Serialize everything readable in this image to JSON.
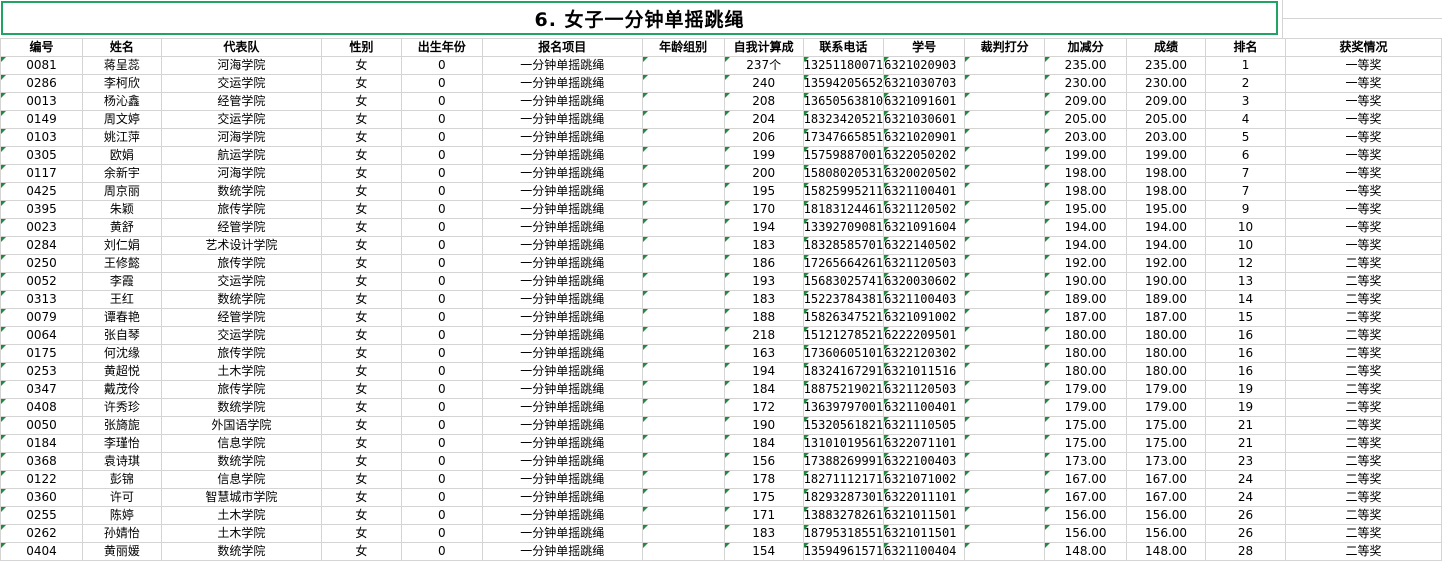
{
  "sheet": {
    "title": "6.  女子一分钟单摇跳绳",
    "headers": [
      "编号",
      "姓名",
      "代表队",
      "性别",
      "出生年份",
      "报名项目",
      "年龄组别",
      "自我计算成",
      "联系电话",
      "学号",
      "裁判打分",
      "加减分",
      "成绩",
      "排名",
      "获奖情况"
    ],
    "rows": [
      [
        "0081",
        "蒋呈蕊",
        "河海学院",
        "女",
        "0",
        "一分钟单摇跳绳",
        "",
        "237个",
        "13251180071",
        "6321020903",
        "",
        "235.00",
        "235.00",
        "1",
        "一等奖"
      ],
      [
        "0286",
        "李柯欣",
        "交运学院",
        "女",
        "0",
        "一分钟单摇跳绳",
        "",
        "240",
        "13594205652",
        "6321030703",
        "",
        "230.00",
        "230.00",
        "2",
        "一等奖"
      ],
      [
        "0013",
        "杨沁鑫",
        "经管学院",
        "女",
        "0",
        "一分钟单摇跳绳",
        "",
        "208",
        "13650563810",
        "6321091601",
        "",
        "209.00",
        "209.00",
        "3",
        "一等奖"
      ],
      [
        "0149",
        "周文婷",
        "交运学院",
        "女",
        "0",
        "一分钟单摇跳绳",
        "",
        "204",
        "18323420521",
        "6321030601",
        "",
        "205.00",
        "205.00",
        "4",
        "一等奖"
      ],
      [
        "0103",
        "姚江萍",
        "河海学院",
        "女",
        "0",
        "一分钟单摇跳绳",
        "",
        "206",
        "17347665851",
        "6321020901",
        "",
        "203.00",
        "203.00",
        "5",
        "一等奖"
      ],
      [
        "0305",
        "欧娟",
        "航运学院",
        "女",
        "0",
        "一分钟单摇跳绳",
        "",
        "199",
        "15759887001",
        "6322050202",
        "",
        "199.00",
        "199.00",
        "6",
        "一等奖"
      ],
      [
        "0117",
        "余新宇",
        "河海学院",
        "女",
        "0",
        "一分钟单摇跳绳",
        "",
        "200",
        "15808020531",
        "6320020502",
        "",
        "198.00",
        "198.00",
        "7",
        "一等奖"
      ],
      [
        "0425",
        "周京丽",
        "数统学院",
        "女",
        "0",
        "一分钟单摇跳绳",
        "",
        "195",
        "15825995211",
        "6321100401",
        "",
        "198.00",
        "198.00",
        "7",
        "一等奖"
      ],
      [
        "0395",
        "朱颖",
        "旅传学院",
        "女",
        "0",
        "一分钟单摇跳绳",
        "",
        "170",
        "18183124461",
        "6321120502",
        "",
        "195.00",
        "195.00",
        "9",
        "一等奖"
      ],
      [
        "0023",
        "黄舒",
        "经管学院",
        "女",
        "0",
        "一分钟单摇跳绳",
        "",
        "194",
        "13392709081",
        "6321091604",
        "",
        "194.00",
        "194.00",
        "10",
        "一等奖"
      ],
      [
        "0284",
        "刘仁娟",
        "艺术设计学院",
        "女",
        "0",
        "一分钟单摇跳绳",
        "",
        "183",
        "18328585701",
        "6322140502",
        "",
        "194.00",
        "194.00",
        "10",
        "一等奖"
      ],
      [
        "0250",
        "王修懿",
        "旅传学院",
        "女",
        "0",
        "一分钟单摇跳绳",
        "",
        "186",
        "17265664261",
        "6321120503",
        "",
        "192.00",
        "192.00",
        "12",
        "二等奖"
      ],
      [
        "0052",
        "李霞",
        "交运学院",
        "女",
        "0",
        "一分钟单摇跳绳",
        "",
        "193",
        "15683025741",
        "6320030602",
        "",
        "190.00",
        "190.00",
        "13",
        "二等奖"
      ],
      [
        "0313",
        "王红",
        "数统学院",
        "女",
        "0",
        "一分钟单摇跳绳",
        "",
        "183",
        "15223784381",
        "6321100403",
        "",
        "189.00",
        "189.00",
        "14",
        "二等奖"
      ],
      [
        "0079",
        "谭春艳",
        "经管学院",
        "女",
        "0",
        "一分钟单摇跳绳",
        "",
        "188",
        "15826347521",
        "6321091002",
        "",
        "187.00",
        "187.00",
        "15",
        "二等奖"
      ],
      [
        "0064",
        "张自琴",
        "交运学院",
        "女",
        "0",
        "一分钟单摇跳绳",
        "",
        "218",
        "15121278521",
        "6222209501",
        "",
        "180.00",
        "180.00",
        "16",
        "二等奖"
      ],
      [
        "0175",
        "何沈缘",
        "旅传学院",
        "女",
        "0",
        "一分钟单摇跳绳",
        "",
        "163",
        "17360605101",
        "6322120302",
        "",
        "180.00",
        "180.00",
        "16",
        "二等奖"
      ],
      [
        "0253",
        "黄超悦",
        "土木学院",
        "女",
        "0",
        "一分钟单摇跳绳",
        "",
        "194",
        "18324167291",
        "6321011516",
        "",
        "180.00",
        "180.00",
        "16",
        "二等奖"
      ],
      [
        "0347",
        "戴茂伶",
        "旅传学院",
        "女",
        "0",
        "一分钟单摇跳绳",
        "",
        "184",
        "18875219021",
        "6321120503",
        "",
        "179.00",
        "179.00",
        "19",
        "二等奖"
      ],
      [
        "0408",
        "许秀珍",
        "数统学院",
        "女",
        "0",
        "一分钟单摇跳绳",
        "",
        "172",
        "13639797001",
        "6321100401",
        "",
        "179.00",
        "179.00",
        "19",
        "二等奖"
      ],
      [
        "0050",
        "张旖旎",
        "外国语学院",
        "女",
        "0",
        "一分钟单摇跳绳",
        "",
        "190",
        "15320561821",
        "6321110505",
        "",
        "175.00",
        "175.00",
        "21",
        "二等奖"
      ],
      [
        "0184",
        "李瑾怡",
        "信息学院",
        "女",
        "0",
        "一分钟单摇跳绳",
        "",
        "184",
        "13101019561",
        "6322071101",
        "",
        "175.00",
        "175.00",
        "21",
        "二等奖"
      ],
      [
        "0368",
        "袁诗琪",
        "数统学院",
        "女",
        "0",
        "一分钟单摇跳绳",
        "",
        "156",
        "17388269991",
        "6322100403",
        "",
        "173.00",
        "173.00",
        "23",
        "二等奖"
      ],
      [
        "0122",
        "彭锦",
        "信息学院",
        "女",
        "0",
        "一分钟单摇跳绳",
        "",
        "178",
        "18271112171",
        "6321071002",
        "",
        "167.00",
        "167.00",
        "24",
        "二等奖"
      ],
      [
        "0360",
        "许可",
        "智慧城市学院",
        "女",
        "0",
        "一分钟单摇跳绳",
        "",
        "175",
        "18293287301",
        "6322011101",
        "",
        "167.00",
        "167.00",
        "24",
        "二等奖"
      ],
      [
        "0255",
        "陈婷",
        "土木学院",
        "女",
        "0",
        "一分钟单摇跳绳",
        "",
        "171",
        "13883278261",
        "6321011501",
        "",
        "156.00",
        "156.00",
        "26",
        "二等奖"
      ],
      [
        "0262",
        "孙婧怡",
        "土木学院",
        "女",
        "0",
        "一分钟单摇跳绳",
        "",
        "183",
        "18795318551",
        "6321011501",
        "",
        "156.00",
        "156.00",
        "26",
        "二等奖"
      ],
      [
        "0404",
        "黄丽媛",
        "数统学院",
        "女",
        "0",
        "一分钟单摇跳绳",
        "",
        "154",
        "13594961571",
        "6321100404",
        "",
        "148.00",
        "148.00",
        "28",
        "二等奖"
      ]
    ]
  }
}
